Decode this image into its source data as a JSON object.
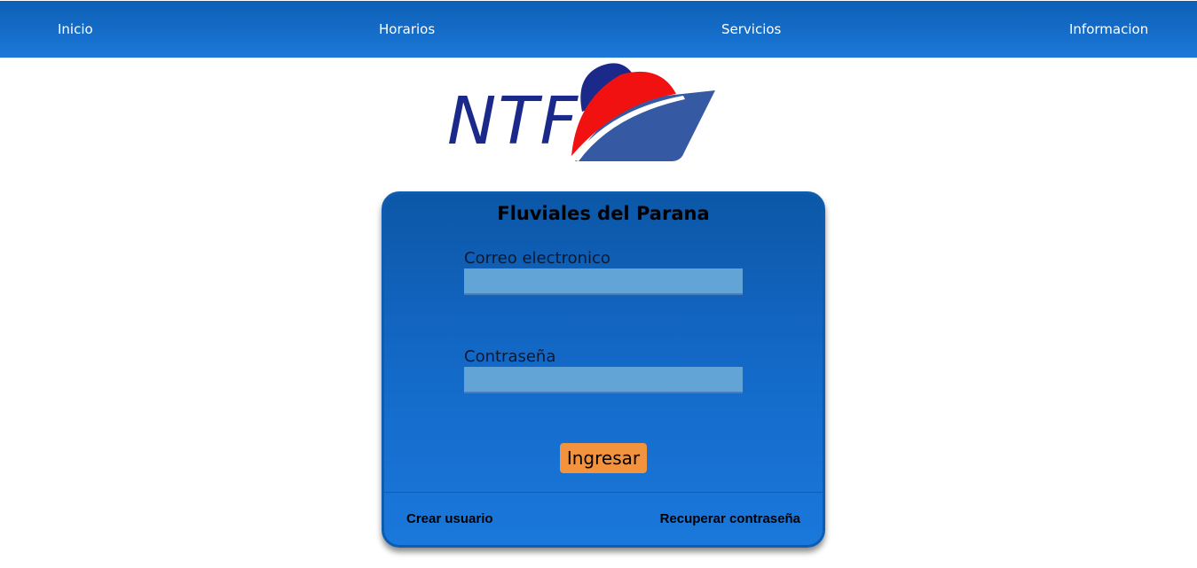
{
  "nav": {
    "items": [
      {
        "label": "Inicio"
      },
      {
        "label": "Horarios"
      },
      {
        "label": "Servicios"
      },
      {
        "label": "Informacion"
      }
    ]
  },
  "logo": {
    "text": "NTF",
    "colors": {
      "text": "#1b2a8a",
      "red": "#f21111",
      "navy": "#1b2a8a",
      "hull": "#3659a3"
    }
  },
  "login": {
    "title": "Fluviales del Parana",
    "email": {
      "label": "Correo electronico",
      "value": "",
      "placeholder": ""
    },
    "password": {
      "label": "Contraseña",
      "value": "",
      "placeholder": ""
    },
    "submit_label": "Ingresar",
    "create_user_label": "Crear usuario",
    "recover_password_label": "Recuperar contraseña"
  },
  "colors": {
    "navbar": "#1566c4",
    "card": "#1368c6",
    "input": "#62a4d6",
    "button": "#f4933d"
  }
}
